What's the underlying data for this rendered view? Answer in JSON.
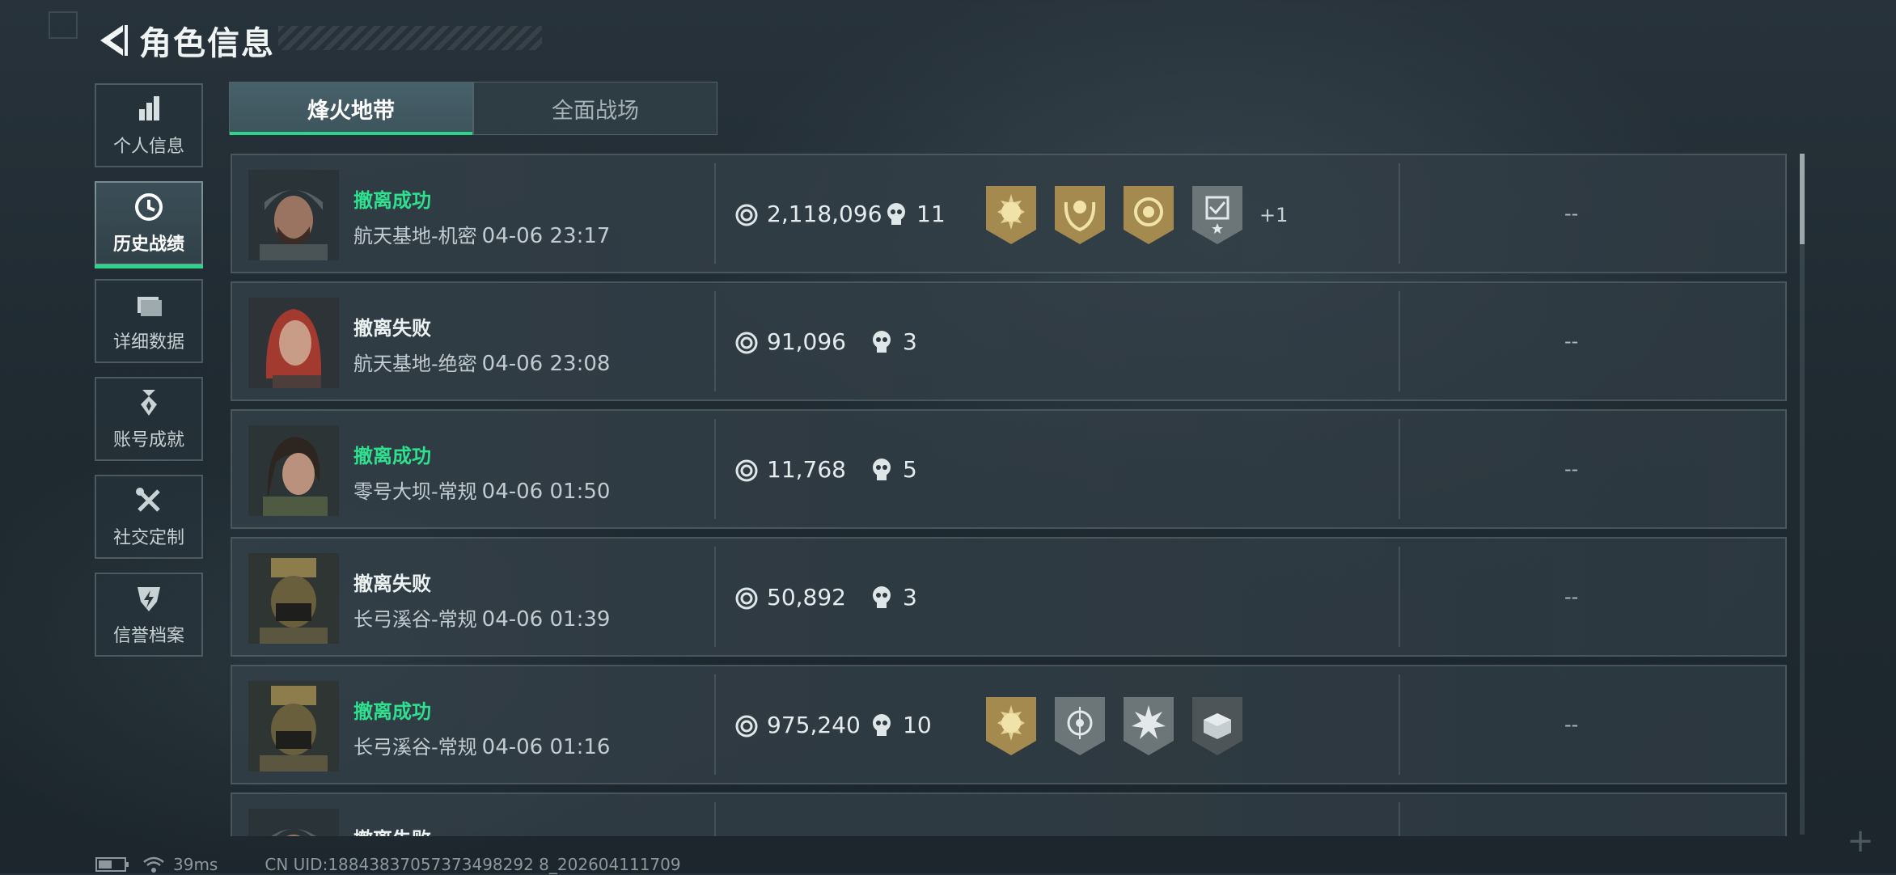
{
  "header": {
    "title": "角色信息"
  },
  "sidebar": {
    "items": [
      {
        "label": "个人信息",
        "icon": "bar-chart-icon"
      },
      {
        "label": "历史战绩",
        "icon": "clock-icon",
        "active": true
      },
      {
        "label": "详细数据",
        "icon": "folder-icon"
      },
      {
        "label": "账号成就",
        "icon": "medal-icon"
      },
      {
        "label": "社交定制",
        "icon": "tools-icon"
      },
      {
        "label": "信誉档案",
        "icon": "shield-icon"
      }
    ]
  },
  "tabs": [
    {
      "label": "烽火地带",
      "active": true
    },
    {
      "label": "全面战场",
      "active": false
    }
  ],
  "records": [
    {
      "status": "撤离成功",
      "result": "success",
      "map": "航天基地-机密",
      "time": "04-06 23:17",
      "value": "2,118,096",
      "kills": "11",
      "badges": [
        "gold-sun-badge",
        "gold-wreath-badge",
        "gold-coin-badge",
        "silver-checklist-badge"
      ],
      "extra": "+1",
      "rating": "--"
    },
    {
      "status": "撤离失败",
      "result": "fail",
      "map": "航天基地-绝密",
      "time": "04-06 23:08",
      "value": "91,096",
      "kills": "3",
      "badges": [],
      "extra": "",
      "rating": "--"
    },
    {
      "status": "撤离成功",
      "result": "success",
      "map": "零号大坝-常规",
      "time": "04-06 01:50",
      "value": "11,768",
      "kills": "5",
      "badges": [],
      "extra": "",
      "rating": "--"
    },
    {
      "status": "撤离失败",
      "result": "fail",
      "map": "长弓溪谷-常规",
      "time": "04-06 01:39",
      "value": "50,892",
      "kills": "3",
      "badges": [],
      "extra": "",
      "rating": "--"
    },
    {
      "status": "撤离成功",
      "result": "success",
      "map": "长弓溪谷-常规",
      "time": "04-06 01:16",
      "value": "975,240",
      "kills": "10",
      "badges": [
        "gold-sun-badge",
        "silver-target-badge",
        "silver-burst-badge",
        "dark-box-badge"
      ],
      "extra": "",
      "rating": "--"
    },
    {
      "status": "撤离失败",
      "result": "fail",
      "map": "",
      "time": "",
      "value": "",
      "kills": "",
      "badges": [],
      "extra": "",
      "rating": ""
    }
  ],
  "footer": {
    "ping": "39ms",
    "uid": "CN UID:18843837057373498292 8_202604111709"
  },
  "colors": {
    "success": "#2fe08f",
    "accent": "#2fd58a",
    "background": "#212c33"
  }
}
